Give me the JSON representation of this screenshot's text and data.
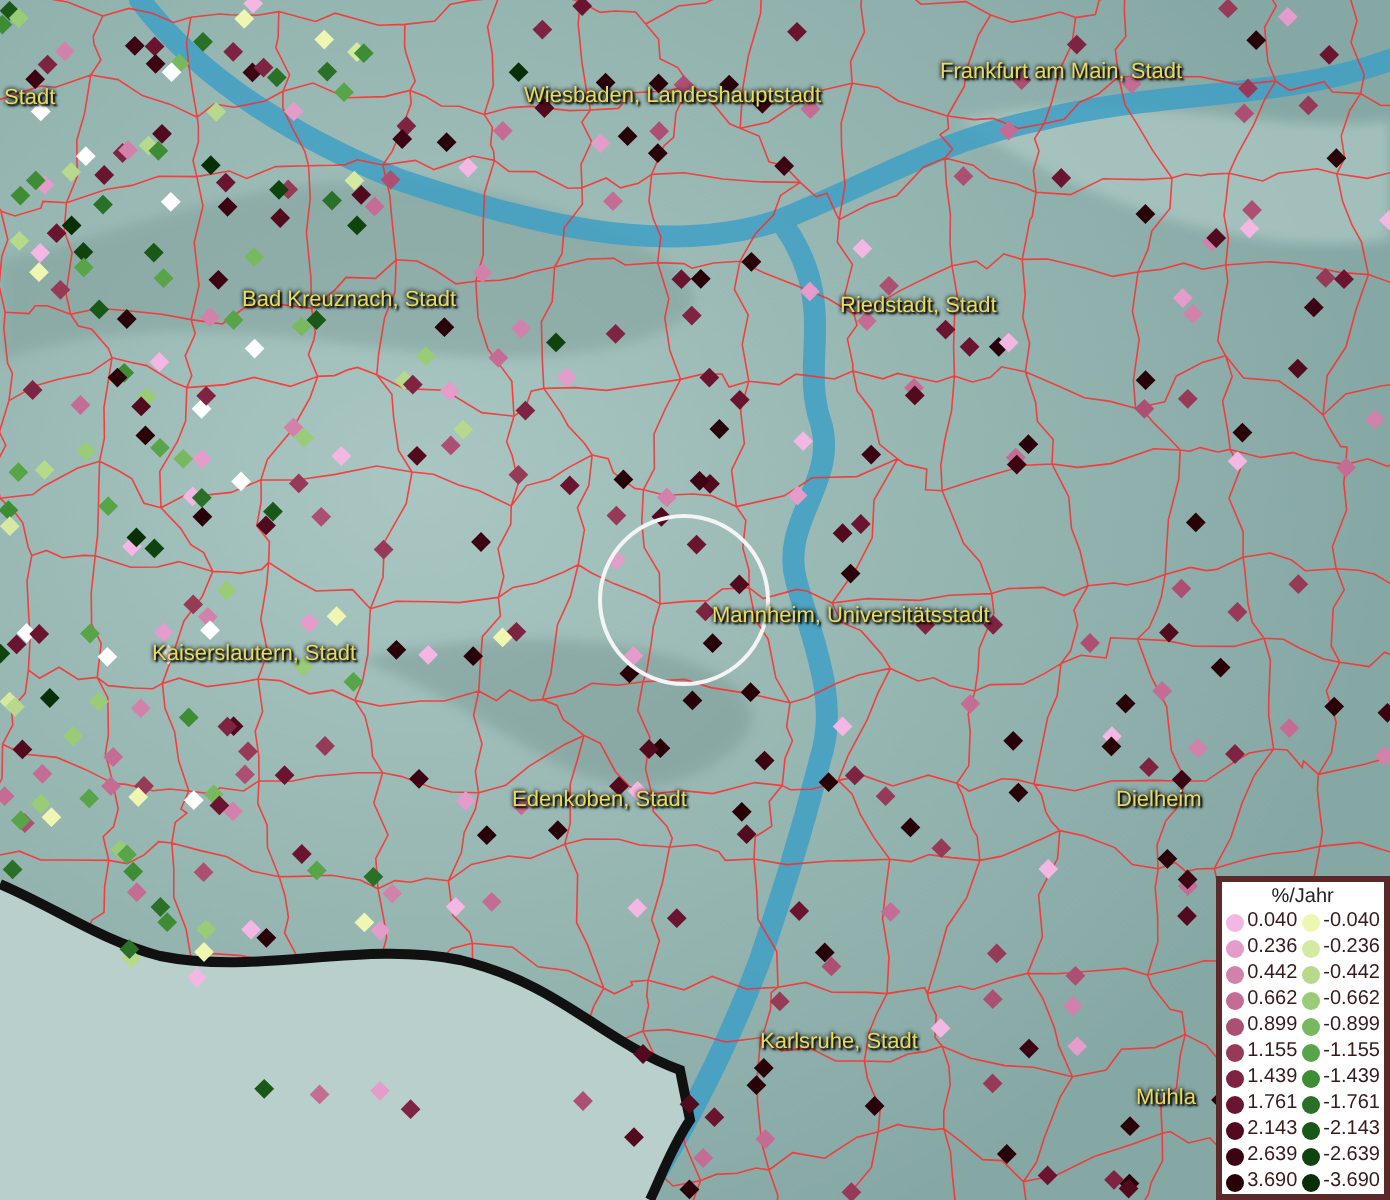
{
  "map": {
    "places": [
      {
        "name": "Stadt"
      },
      {
        "name": "Wiesbaden, Landeshauptstadt"
      },
      {
        "name": "Frankfurt am Main, Stadt"
      },
      {
        "name": "Bad Kreuznach, Stadt"
      },
      {
        "name": "Riedstadt, Stadt"
      },
      {
        "name": "Mannheim, Universitätsstadt"
      },
      {
        "name": "Kaiserslautern, Stadt"
      },
      {
        "name": "Edenkoben, Stadt"
      },
      {
        "name": "Dielheim"
      },
      {
        "name": "Karlsruhe, Stadt"
      },
      {
        "name": "Mühla"
      }
    ]
  },
  "legend": {
    "title": "%/Jahr",
    "positive": [
      {
        "value": "0.040",
        "color": "#f4b6e2"
      },
      {
        "value": "0.236",
        "color": "#e49ccb"
      },
      {
        "value": "0.442",
        "color": "#d281ab"
      },
      {
        "value": "0.662",
        "color": "#c46c93"
      },
      {
        "value": "0.899",
        "color": "#ad4f72"
      },
      {
        "value": "1.155",
        "color": "#973a58"
      },
      {
        "value": "1.439",
        "color": "#7e2442"
      },
      {
        "value": "1.761",
        "color": "#6a1430"
      },
      {
        "value": "2.143",
        "color": "#520a1e"
      },
      {
        "value": "2.639",
        "color": "#3c0412"
      },
      {
        "value": "3.690",
        "color": "#280208"
      }
    ],
    "negative": [
      {
        "value": "-0.040",
        "color": "#eef6b2"
      },
      {
        "value": "-0.236",
        "color": "#d4eaa2"
      },
      {
        "value": "-0.442",
        "color": "#b6d98b"
      },
      {
        "value": "-0.662",
        "color": "#9acb76"
      },
      {
        "value": "-0.899",
        "color": "#78b85e"
      },
      {
        "value": "-1.155",
        "color": "#58a448"
      },
      {
        "value": "-1.439",
        "color": "#3e8c34"
      },
      {
        "value": "-1.761",
        "color": "#2a7026"
      },
      {
        "value": "-2.143",
        "color": "#1a5818"
      },
      {
        "value": "-2.639",
        "color": "#0f440f"
      },
      {
        "value": "-3.690",
        "color": "#073007"
      }
    ]
  }
}
